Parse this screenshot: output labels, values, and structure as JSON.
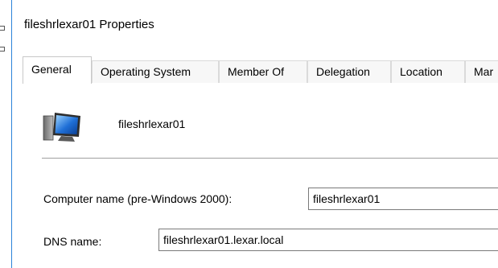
{
  "window": {
    "title": "fileshrlexar01 Properties"
  },
  "tabs": [
    {
      "label": "General",
      "active": true
    },
    {
      "label": "Operating System",
      "active": false
    },
    {
      "label": "Member Of",
      "active": false
    },
    {
      "label": "Delegation",
      "active": false
    },
    {
      "label": "Location",
      "active": false
    },
    {
      "label": "Mar",
      "active": false
    }
  ],
  "general": {
    "icon": "computer-icon",
    "name": "fileshrlexar01",
    "computer_name_label": "Computer name (pre-Windows 2000):",
    "computer_name_value": "fileshrlexar01",
    "dns_name_label": "DNS name:",
    "dns_name_value": "fileshrlexar01.lexar.local"
  },
  "colors": {
    "accent": "#2b83d9",
    "tab_border": "#dadada",
    "field_border": "#7a7a7a"
  }
}
